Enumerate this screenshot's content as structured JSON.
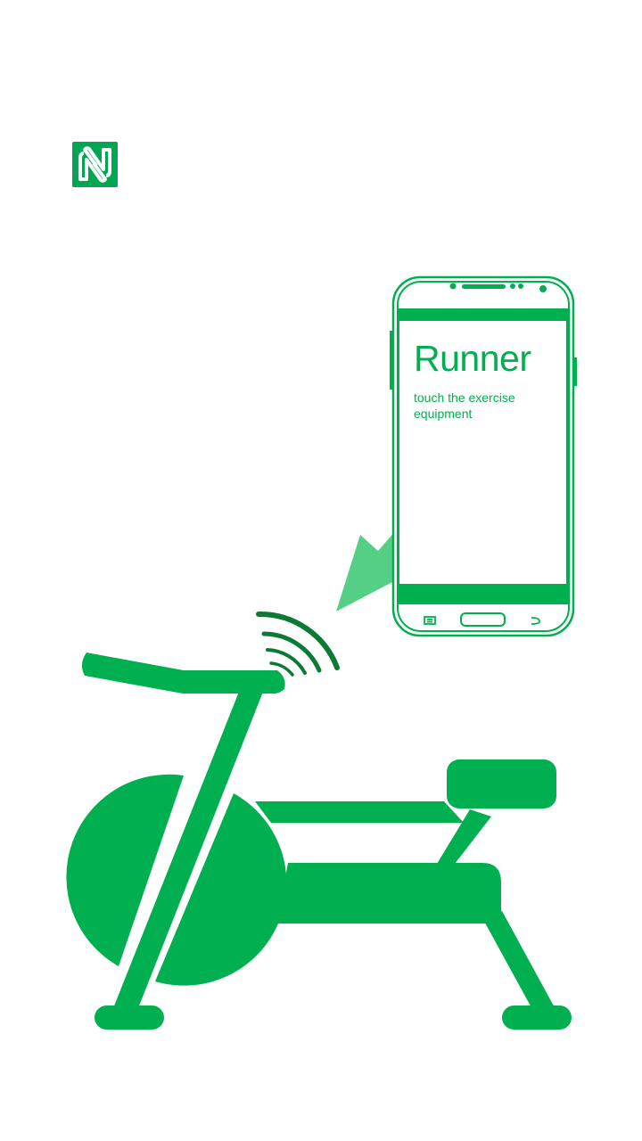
{
  "app": {
    "title": "Runner",
    "instruction": "touch the exercise equipment"
  },
  "icons": {
    "nfc": "nfc-icon",
    "signal": "nfc-signal-waves-icon",
    "arrow": "tap-direction-arrow-icon",
    "equipment": "exercise-bike-icon",
    "menu": "menu-icon",
    "home": "home-button-icon",
    "back": "back-icon"
  },
  "colors": {
    "brand": "#00b050",
    "dark_green": "#0a7a35",
    "arrow": "#3cc874",
    "background": "#ffffff"
  }
}
